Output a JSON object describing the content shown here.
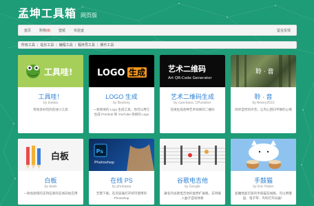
{
  "header": {
    "title": "孟坤工具箱",
    "subtitle": "网页版"
  },
  "nav": {
    "items": [
      {
        "label": "首页"
      },
      {
        "label": "购物",
        "badge": "(8)"
      },
      {
        "label": "壁纸"
      },
      {
        "label": "实验室"
      }
    ],
    "feedback": "留言反馈"
  },
  "breadcrumbs": [
    "所有工具",
    "站长工具",
    "编程工具",
    "程序员工具",
    "娱乐工具"
  ],
  "cards": [
    {
      "title": "工具哇！",
      "author": "by toolwa",
      "desc": "有很多好玩的在线小工具",
      "thumb_text": "工具哇!"
    },
    {
      "title": "LOGO 生成",
      "author": "by Bestony",
      "desc": "一款简易的 Logo 生成工具，你可以用它生成 Pornhub 和 YouTube 风格的 Logo",
      "thumb_text_a": "LOGO",
      "thumb_text_b": "生成"
    },
    {
      "title": "艺术二维码生成",
      "author": "by cuechaos, CPunisher",
      "desc": "在线生成各种艺术效果的二维码",
      "thumb_text_a": "艺术二维码",
      "thumb_text_b": "Art QR-Code Generator"
    },
    {
      "title": "聆 · 音",
      "author": "by Amery2010",
      "desc": "倾听自然的声音，让内心回归平静的心情",
      "thumb_text": "聆 · 音"
    },
    {
      "title": "白板",
      "author": "by daidr",
      "desc": "一款高颜值的支持压感的在线白板应用",
      "thumb_text": "白板"
    },
    {
      "title": "在线 PS",
      "author": "by photopea",
      "desc": "无需下载，在浏览器打开即可使用的 Photoshop",
      "thumb_text_a": "Ps",
      "thumb_text_b": "Photoshop"
    },
    {
      "title": "谷歌电吉他",
      "author": "by Google",
      "desc": "著名的谷歌电吉他的复原扩展版，支持输入曲子自动弹奏",
      "thumb_text": ""
    },
    {
      "title": "手鼓猫",
      "author": "by Eric Huber",
      "desc": "超魔性超可爱的手鼓猫在线版，可以用键盘、电子琴、鸟鸣打开乐器！",
      "thumb_text": ""
    }
  ],
  "colors": {
    "background": "#1e9b77",
    "link": "#2a7fd4",
    "badge": "#e02b2b"
  }
}
